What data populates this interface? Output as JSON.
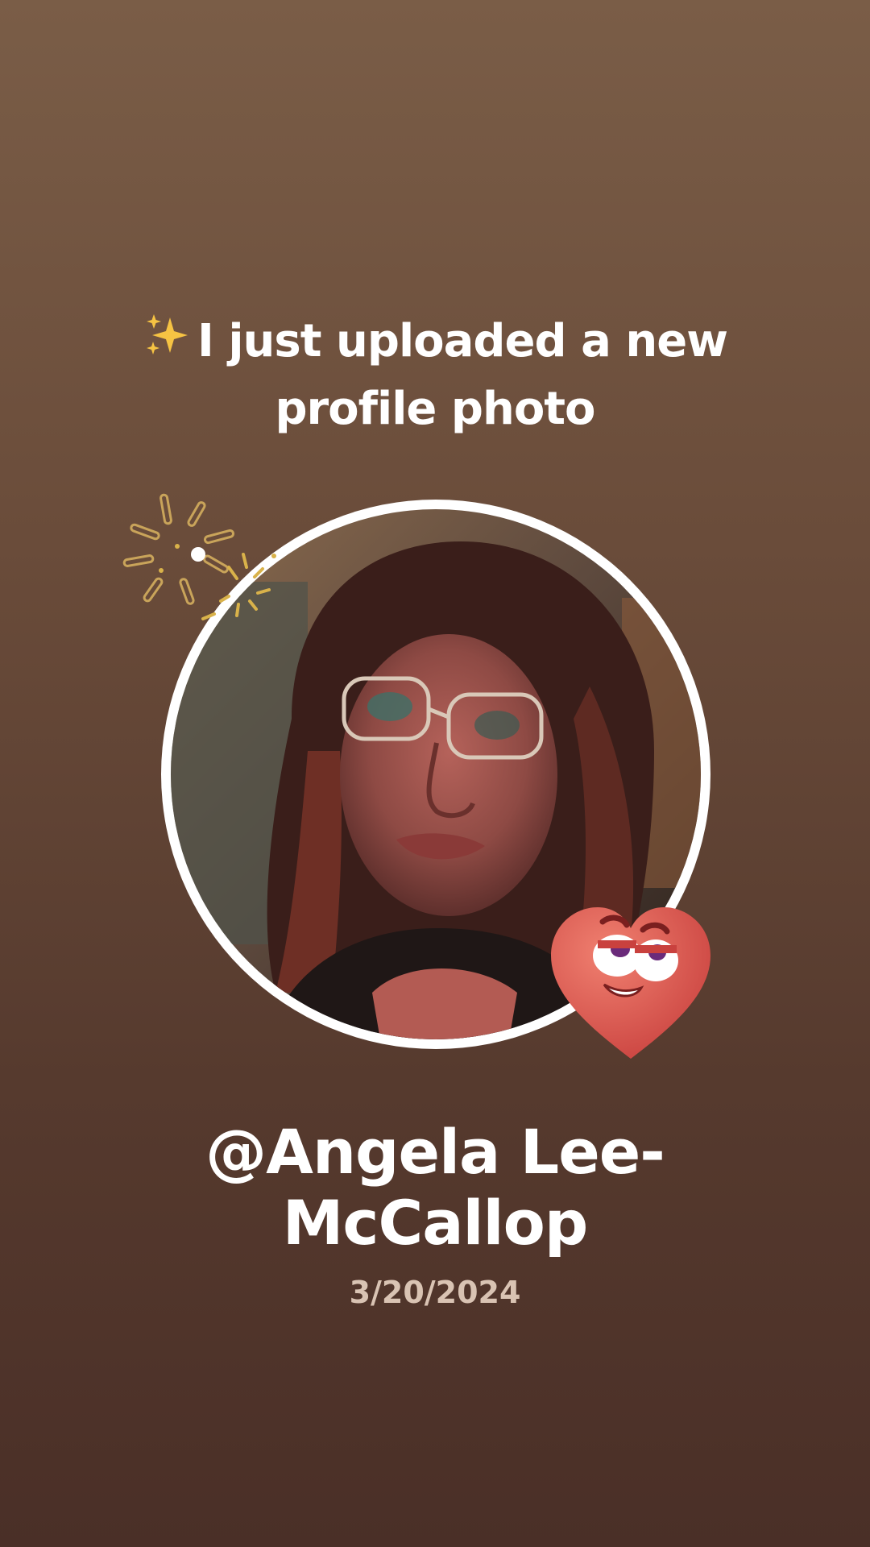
{
  "post": {
    "sparkle_icon": "sparkles-emoji",
    "headline": "I just uploaded a new profile photo",
    "username": "@Angela Lee-McCallop",
    "date": "3/20/2024"
  },
  "colors": {
    "background_top": "#7a5d47",
    "background_bottom": "#4a2f27",
    "ring": "#ffffff",
    "heart": "#e0584f",
    "burst": "#d9b24a"
  },
  "decorations": {
    "burst_icon": "confetti-burst-icon",
    "heart_icon": "heart-face-sticker-icon"
  }
}
